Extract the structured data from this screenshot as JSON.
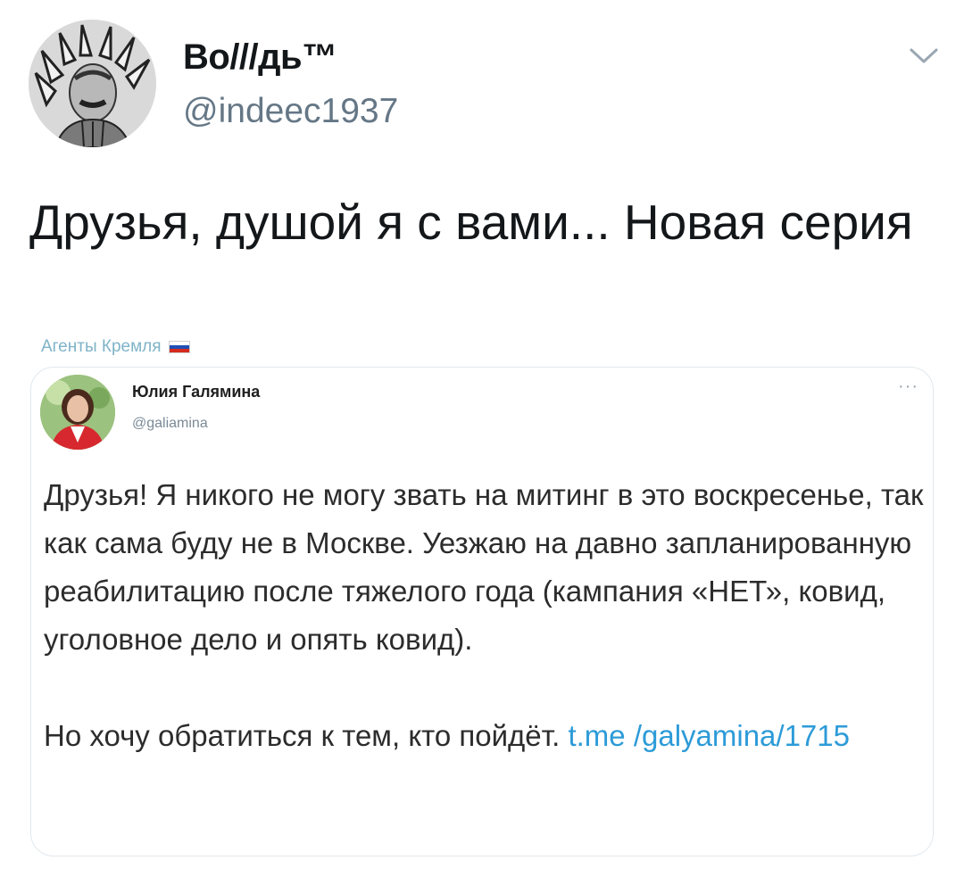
{
  "tweet": {
    "author_name": "Во///дь™",
    "author_handle": "@indeec1937",
    "text": "Друзья, душой я с вами... Новая серия",
    "source_label": "Агенты Кремля"
  },
  "quoted_screenshot": {
    "author_name": "Юлия Галямина",
    "author_handle": "@galiamina",
    "more_label": "···",
    "paragraph_1": "Друзья! Я никого не могу звать на митинг в это воскресенье, так как сама буду не в Москве. Уезжаю на давно запланированную реабилитацию после тяжелого года (кампания «НЕТ», ковид, уголовное дело и опять ковид).",
    "paragraph_2_text": "Но хочу обратиться к тем, кто пойдёт.",
    "paragraph_2_link": "t.me /galyamina/1715"
  },
  "colors": {
    "text_primary": "#14171a",
    "text_secondary": "#657786",
    "link": "#2d9bd8",
    "source_label": "#7fb3c8",
    "card_border": "#e1e8ed"
  },
  "icons": {
    "menu": "chevron-down-icon",
    "source_flag": "russian-flag-icon"
  }
}
